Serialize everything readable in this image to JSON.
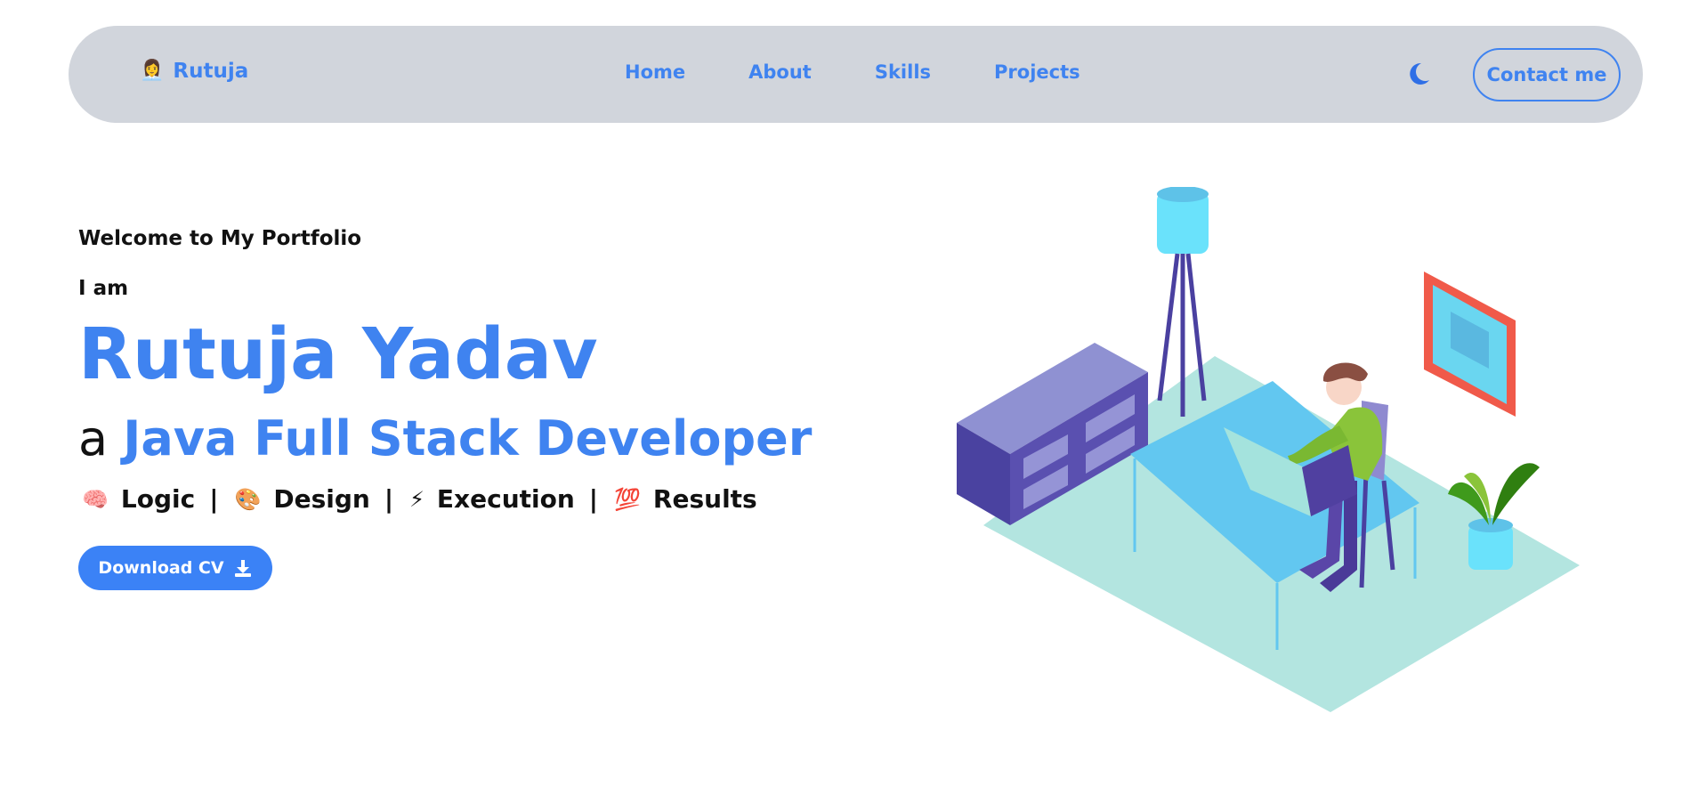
{
  "nav": {
    "brand_emoji": "👩‍💼",
    "brand_name": "Rutuja",
    "links": [
      {
        "label": "Home"
      },
      {
        "label": "About"
      },
      {
        "label": "Skills"
      },
      {
        "label": "Projects"
      }
    ],
    "theme_icon": "moon-icon",
    "contact_label": "Contact me"
  },
  "hero": {
    "welcome": "Welcome to My Portfolio",
    "intro": "I am",
    "name": "Rutuja Yadav",
    "article": "a",
    "role": "Java Full Stack Developer",
    "traits": [
      {
        "emoji": "🧠",
        "label": "Logic",
        "sep": "|"
      },
      {
        "emoji": "🎨",
        "label": "Design",
        "sep": "|"
      },
      {
        "emoji": "⚡",
        "label": "Execution",
        "sep": "|"
      },
      {
        "emoji": "💯",
        "label": "Results",
        "sep": ""
      }
    ],
    "download_label": "Download CV",
    "download_icon": "download-icon"
  },
  "colors": {
    "accent": "#3f83f0",
    "navbar_bg": "#d1d5dc",
    "button_bg": "#3b82f6"
  },
  "illustration": {
    "icon": "developer-workspace-illustration"
  }
}
